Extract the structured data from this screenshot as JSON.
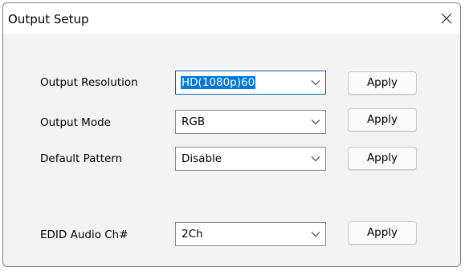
{
  "window": {
    "title": "Output Setup",
    "close_icon": "close-icon"
  },
  "rows": [
    {
      "label": "Output Resolution",
      "value": "HD(1080p)60",
      "button": "Apply",
      "focused": true
    },
    {
      "label": "Output Mode",
      "value": "RGB",
      "button": "Apply"
    },
    {
      "label": "Default Pattern",
      "value": "Disable",
      "button": "Apply"
    },
    {
      "label": "EDID Audio Ch#",
      "value": "2Ch",
      "button": "Apply"
    }
  ],
  "icons": {
    "dropdown": "chevron-down-icon"
  },
  "colors": {
    "accent": "#0078d7",
    "focus_border": "#0067c0"
  }
}
